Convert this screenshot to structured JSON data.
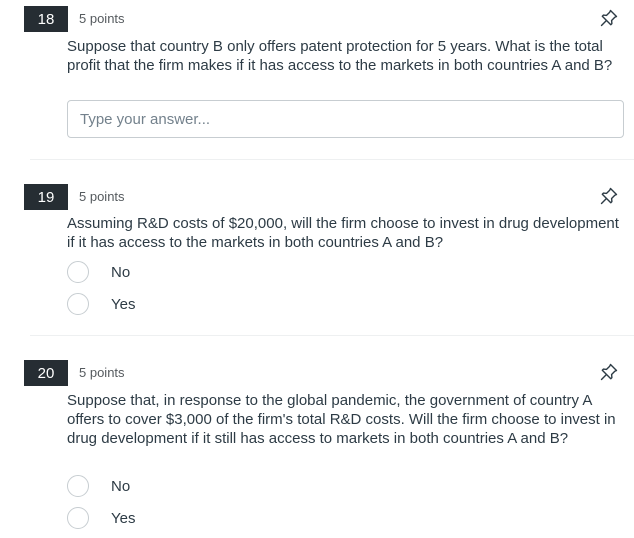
{
  "questions": [
    {
      "number": "18",
      "points": "5 points",
      "text": "Suppose that country B only offers patent protection for 5 years. What is the total profit that the firm makes if it has access to the markets in both countries A and B?",
      "answer_placeholder": "Type your answer..."
    },
    {
      "number": "19",
      "points": "5 points",
      "text": "Assuming R&D costs of $20,000, will the firm choose to invest in drug development if it has access to the markets in both countries A and B?",
      "options": [
        "No",
        "Yes"
      ]
    },
    {
      "number": "20",
      "points": "5 points",
      "text": "Suppose that, in response to the global pandemic, the government of country A offers to cover $3,000 of the firm's total R&D costs. Will the firm choose to invest in drug development if it still has access to markets in both countries A and B?",
      "options": [
        "No",
        "Yes"
      ]
    }
  ],
  "icons": {
    "pin": "pushpin-icon"
  }
}
